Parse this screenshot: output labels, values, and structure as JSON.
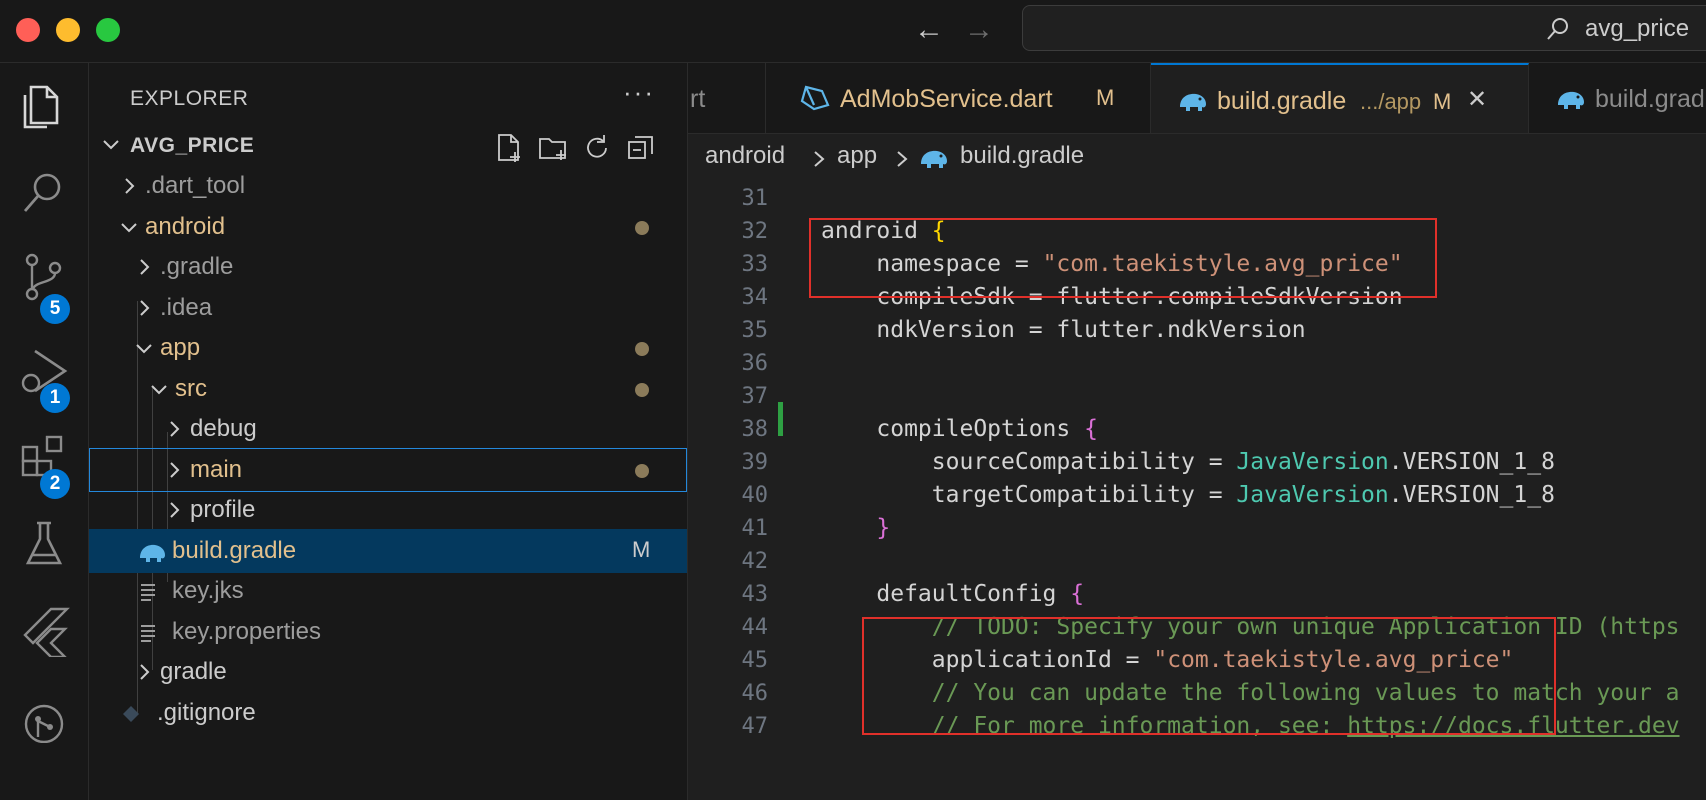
{
  "window": {
    "search_text": "avg_price",
    "nav_back": "←",
    "nav_forward": "→"
  },
  "activity_bar": {
    "items": [
      {
        "name": "explorer-icon",
        "badge": ""
      },
      {
        "name": "search-icon",
        "badge": ""
      },
      {
        "name": "source-control-icon",
        "badge": "5"
      },
      {
        "name": "run-debug-icon",
        "badge": "1"
      },
      {
        "name": "extensions-icon",
        "badge": "2"
      },
      {
        "name": "testing-icon",
        "badge": ""
      },
      {
        "name": "flutter-icon",
        "badge": ""
      },
      {
        "name": "git-graph-icon",
        "badge": ""
      }
    ]
  },
  "explorer": {
    "title": "EXPLORER",
    "more": "···",
    "project": "AVG_PRICE",
    "tree": [
      {
        "label": ".dart_tool",
        "type": "folder",
        "expanded": false,
        "status": "",
        "color": "#9d9d9d"
      },
      {
        "label": "android",
        "type": "folder",
        "expanded": true,
        "status": "dot",
        "color": "#e2c08d"
      },
      {
        "label": ".gradle",
        "type": "folder",
        "expanded": false,
        "status": "",
        "color": "#9d9d9d"
      },
      {
        "label": ".idea",
        "type": "folder",
        "expanded": false,
        "status": "",
        "color": "#9d9d9d"
      },
      {
        "label": "app",
        "type": "folder",
        "expanded": true,
        "status": "dot",
        "color": "#e2c08d"
      },
      {
        "label": "src",
        "type": "folder",
        "expanded": true,
        "status": "dot",
        "color": "#e2c08d"
      },
      {
        "label": "debug",
        "type": "folder",
        "expanded": false,
        "status": "",
        "color": "#cccccc"
      },
      {
        "label": "main",
        "type": "folder",
        "expanded": false,
        "status": "dot",
        "color": "#e2c08d"
      },
      {
        "label": "profile",
        "type": "folder",
        "expanded": false,
        "status": "",
        "color": "#cccccc"
      },
      {
        "label": "build.gradle",
        "type": "file",
        "status": "M",
        "color": "#e2c08d"
      },
      {
        "label": "key.jks",
        "type": "file",
        "status": "",
        "color": "#9d9d9d"
      },
      {
        "label": "key.properties",
        "type": "file",
        "status": "",
        "color": "#9d9d9d"
      },
      {
        "label": "gradle",
        "type": "folder",
        "expanded": false,
        "status": "",
        "color": "#cccccc"
      },
      {
        "label": ".gitignore",
        "type": "file",
        "status": "",
        "color": "#cccccc"
      }
    ]
  },
  "tabs": [
    {
      "label": "rt",
      "suffix": "",
      "status": ""
    },
    {
      "label": "AdMobService.dart",
      "suffix": "",
      "status": "M"
    },
    {
      "label": "build.gradle",
      "suffix": ".../app",
      "status": "M",
      "close": "✕"
    },
    {
      "label": "build.grad",
      "suffix": "",
      "status": ""
    }
  ],
  "breadcrumb": [
    "android",
    "app",
    "build.gradle"
  ],
  "editor": {
    "lines": [
      {
        "n": "31",
        "code": ""
      },
      {
        "n": "32",
        "code": "android {"
      },
      {
        "n": "33",
        "code": "    namespace = \"com.taekistyle.avg_price\""
      },
      {
        "n": "34",
        "code": "    compileSdk = flutter.compileSdkVersion"
      },
      {
        "n": "35",
        "code": "    ndkVersion = flutter.ndkVersion"
      },
      {
        "n": "36",
        "code": ""
      },
      {
        "n": "37",
        "code": ""
      },
      {
        "n": "38",
        "code": "    compileOptions {"
      },
      {
        "n": "39",
        "code": "        sourceCompatibility = JavaVersion.VERSION_1_8"
      },
      {
        "n": "40",
        "code": "        targetCompatibility = JavaVersion.VERSION_1_8"
      },
      {
        "n": "41",
        "code": "    }"
      },
      {
        "n": "42",
        "code": ""
      },
      {
        "n": "43",
        "code": "    defaultConfig {"
      },
      {
        "n": "44",
        "code": "        // TODO: Specify your own unique Application ID (https"
      },
      {
        "n": "45",
        "code": "        applicationId = \"com.taekistyle.avg_price\""
      },
      {
        "n": "46",
        "code": "        // You can update the following values to match your a"
      },
      {
        "n": "47",
        "code": "        // For more information, see: https://docs.flutter.dev"
      }
    ]
  },
  "colors": {
    "accent": "#0078d4",
    "modified": "#e2c08d",
    "highlight_box": "#e0302a",
    "git_added": "#2ea043"
  }
}
